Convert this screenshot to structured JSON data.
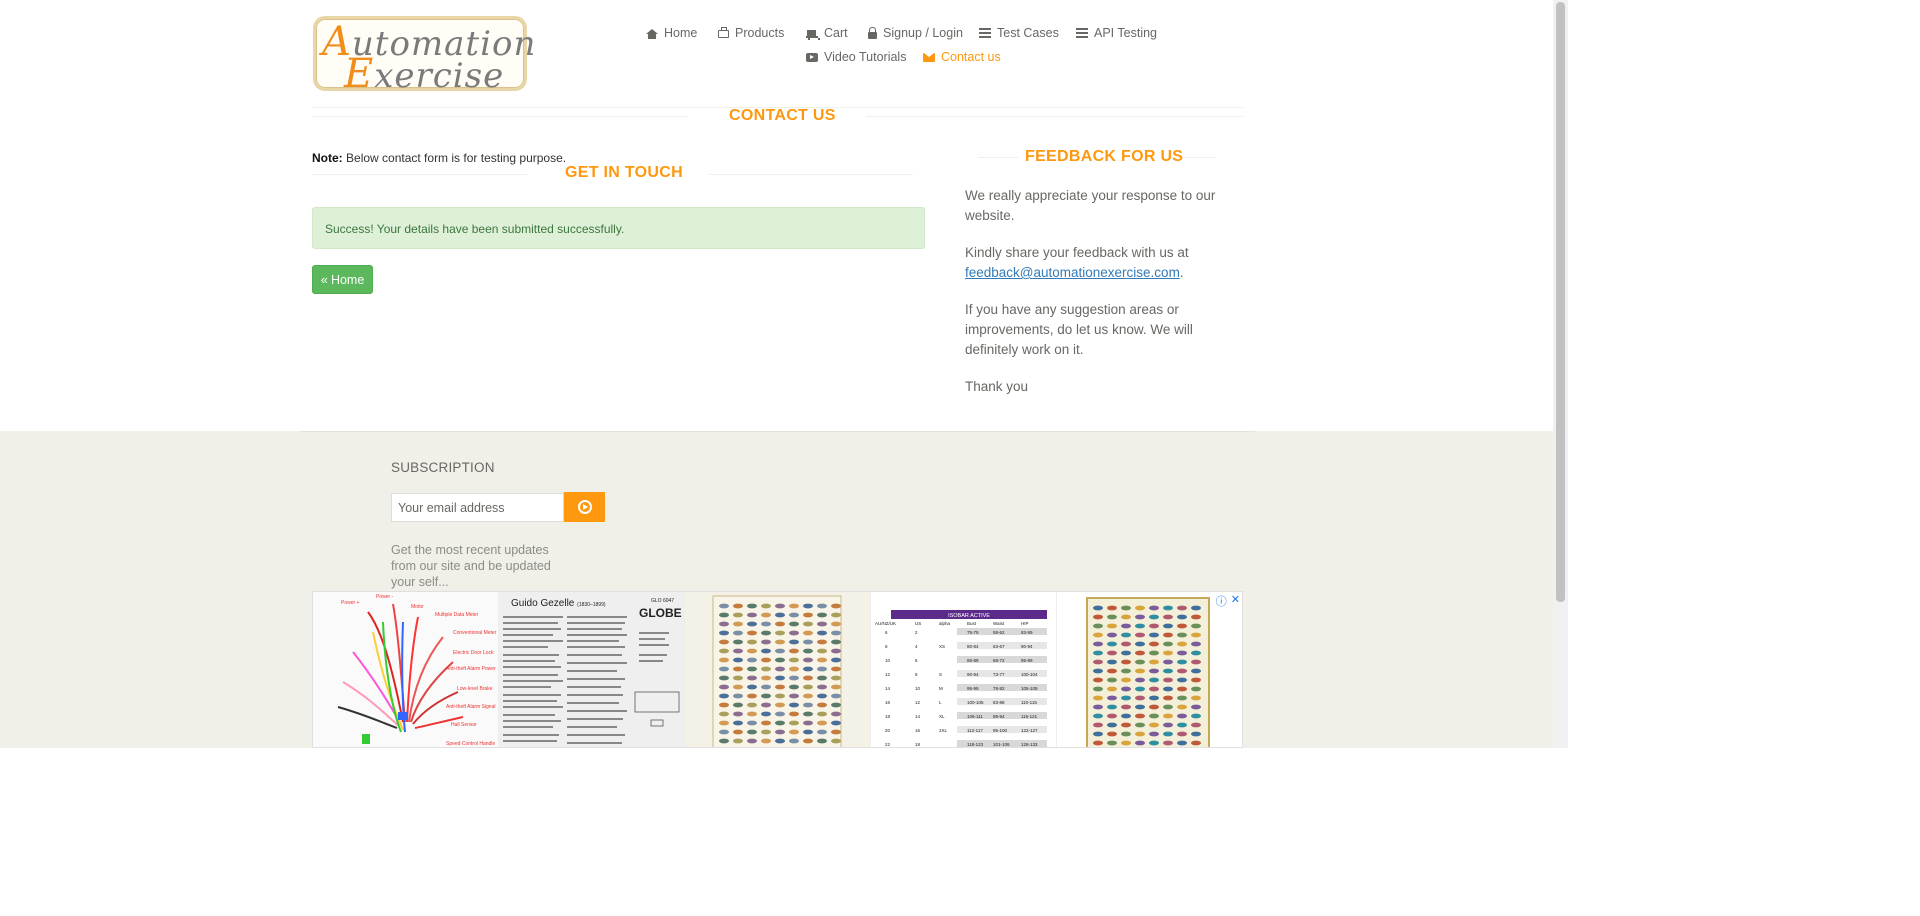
{
  "logo": {
    "line1_first": "A",
    "line1_rest": "utomation",
    "line2_first": "E",
    "line2_rest": "xercise"
  },
  "nav": {
    "items": [
      {
        "label": "Home",
        "icon": "home-icon"
      },
      {
        "label": "Products",
        "icon": "box-icon"
      },
      {
        "label": "Cart",
        "icon": "cart-icon"
      },
      {
        "label": "Signup / Login",
        "icon": "lock-icon"
      },
      {
        "label": "Test Cases",
        "icon": "list-icon"
      },
      {
        "label": "API Testing",
        "icon": "list-icon"
      },
      {
        "label": "Video Tutorials",
        "icon": "play-icon"
      },
      {
        "label": "Contact us",
        "icon": "envelope-icon",
        "active": true
      }
    ]
  },
  "page_title": "CONTACT US",
  "note": {
    "label": "Note:",
    "text": "Below contact form is for testing purpose."
  },
  "get_in_touch": "GET IN TOUCH",
  "success_message": "Success! Your details have been submitted successfully.",
  "home_button": {
    "chevron": "«",
    "label": "Home"
  },
  "feedback": {
    "title": "FEEDBACK FOR US",
    "p1": "We really appreciate your response to our website.",
    "p2_before": "Kindly share your feedback with us at ",
    "p2_email": "feedback@automationexercise.com",
    "p2_after": ".",
    "p3": "If you have any suggestion areas or improvements, do let us know. We will definitely work on it.",
    "p4": "Thank you"
  },
  "subscription": {
    "title": "SUBSCRIPTION",
    "placeholder": "Your email address",
    "text": "Get the most recent updates from our site and be updated your self..."
  },
  "ad": {
    "controls": [
      "ⓘ",
      "✕"
    ],
    "doc": {
      "title": "Guido Gezelle",
      "subtitle": "(1830–1899)",
      "code": "GLO 6047",
      "brand": "GLOBE"
    },
    "sizechart": {
      "title": "ISOBAR ACTIVE",
      "headers": [
        "AU/NZ/UK",
        "US",
        "alpha",
        "Bust",
        "Waist",
        "HIP"
      ],
      "rows": [
        [
          "6",
          "2",
          "",
          "75-79",
          "58-62",
          "83-89"
        ],
        [
          "8",
          "4",
          "XS",
          "80-84",
          "63-67",
          "90-94"
        ],
        [
          "10",
          "6",
          "",
          "85-89",
          "68-72",
          "95-99"
        ],
        [
          "12",
          "8",
          "S",
          "90-94",
          "73-77",
          "100-104"
        ],
        [
          "14",
          "10",
          "M",
          "95-99",
          "78-82",
          "105-109"
        ],
        [
          "16",
          "12",
          "L",
          "100-105",
          "83-88",
          "110-115"
        ],
        [
          "18",
          "14",
          "XL",
          "106-111",
          "89-94",
          "116-121"
        ],
        [
          "20",
          "16",
          "2XL",
          "112-117",
          "95-100",
          "122-127"
        ],
        [
          "22",
          "18",
          "",
          "118-123",
          "101-106",
          "128-133"
        ]
      ]
    }
  },
  "colors": {
    "accent": "#FE980F",
    "success_bg": "#DFF0D8",
    "success_text": "#3C763D",
    "button_green": "#5CB85C",
    "footer_bg": "#F0F0E9"
  }
}
